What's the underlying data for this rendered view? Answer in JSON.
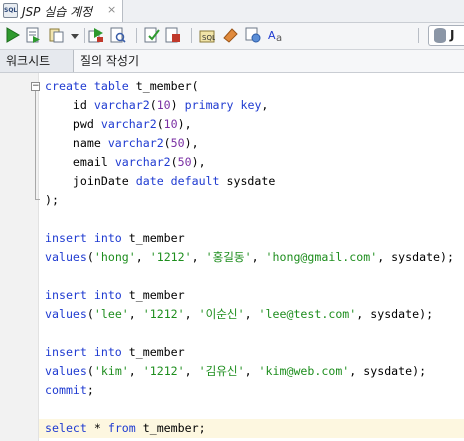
{
  "document_tab": {
    "title": "JSP 실습 계정",
    "close_label": "×",
    "icon": "sql-worksheet-icon"
  },
  "toolbar": {
    "buttons": [
      "run-statement-icon",
      "run-script-icon",
      "commit-icon",
      "dropdown-arrow-icon",
      "rollback-icon",
      "explain-plan-icon",
      "autotrace-icon",
      "sql-history-icon",
      "clear-icon",
      "tuning-icon",
      "format-icon",
      "text-case-icon"
    ],
    "connection_label": "J"
  },
  "subtabs": {
    "worksheet": "워크시트",
    "query_builder": "질의 작성기"
  },
  "editor": {
    "lines": [
      [
        {
          "t": "create table",
          "c": "kw"
        },
        {
          "t": " t_member("
        }
      ],
      [
        {
          "t": "    id "
        },
        {
          "t": "varchar2",
          "c": "kw"
        },
        {
          "t": "("
        },
        {
          "t": "10",
          "c": "num"
        },
        {
          "t": ") "
        },
        {
          "t": "primary key",
          "c": "kw"
        },
        {
          "t": ","
        }
      ],
      [
        {
          "t": "    pwd "
        },
        {
          "t": "varchar2",
          "c": "kw"
        },
        {
          "t": "("
        },
        {
          "t": "10",
          "c": "num"
        },
        {
          "t": "),"
        }
      ],
      [
        {
          "t": "    name "
        },
        {
          "t": "varchar2",
          "c": "kw"
        },
        {
          "t": "("
        },
        {
          "t": "50",
          "c": "num"
        },
        {
          "t": "),"
        }
      ],
      [
        {
          "t": "    email "
        },
        {
          "t": "varchar2",
          "c": "kw"
        },
        {
          "t": "("
        },
        {
          "t": "50",
          "c": "num"
        },
        {
          "t": "),"
        }
      ],
      [
        {
          "t": "    joinDate "
        },
        {
          "t": "date default",
          "c": "kw"
        },
        {
          "t": " sysdate"
        }
      ],
      [
        {
          "t": ");"
        }
      ],
      [],
      [
        {
          "t": "insert into",
          "c": "kw"
        },
        {
          "t": " t_member"
        }
      ],
      [
        {
          "t": "values",
          "c": "kw"
        },
        {
          "t": "("
        },
        {
          "t": "'hong'",
          "c": "str"
        },
        {
          "t": ", "
        },
        {
          "t": "'1212'",
          "c": "str"
        },
        {
          "t": ", "
        },
        {
          "t": "'홍길동'",
          "c": "str"
        },
        {
          "t": ", "
        },
        {
          "t": "'hong@gmail.com'",
          "c": "str"
        },
        {
          "t": ", sysdate);"
        }
      ],
      [],
      [
        {
          "t": "insert into",
          "c": "kw"
        },
        {
          "t": " t_member"
        }
      ],
      [
        {
          "t": "values",
          "c": "kw"
        },
        {
          "t": "("
        },
        {
          "t": "'lee'",
          "c": "str"
        },
        {
          "t": ", "
        },
        {
          "t": "'1212'",
          "c": "str"
        },
        {
          "t": ", "
        },
        {
          "t": "'이순신'",
          "c": "str"
        },
        {
          "t": ", "
        },
        {
          "t": "'lee@test.com'",
          "c": "str"
        },
        {
          "t": ", sysdate);"
        }
      ],
      [],
      [
        {
          "t": "insert into",
          "c": "kw"
        },
        {
          "t": " t_member"
        }
      ],
      [
        {
          "t": "values",
          "c": "kw"
        },
        {
          "t": "("
        },
        {
          "t": "'kim'",
          "c": "str"
        },
        {
          "t": ", "
        },
        {
          "t": "'1212'",
          "c": "str"
        },
        {
          "t": ", "
        },
        {
          "t": "'김유신'",
          "c": "str"
        },
        {
          "t": ", "
        },
        {
          "t": "'kim@web.com'",
          "c": "str"
        },
        {
          "t": ", sysdate);"
        }
      ],
      [
        {
          "t": "commit",
          "c": "kw"
        },
        {
          "t": ";"
        }
      ],
      [],
      [
        {
          "t": "select",
          "c": "kw"
        },
        {
          "t": " * "
        },
        {
          "t": "from",
          "c": "kw"
        },
        {
          "t": " t_member;"
        }
      ]
    ],
    "current_line": 18,
    "colors": {
      "keyword": "#1f3bd1",
      "string": "#1e8e1e",
      "number": "#7a2fa3",
      "current_line": "#fdf7e0"
    }
  }
}
